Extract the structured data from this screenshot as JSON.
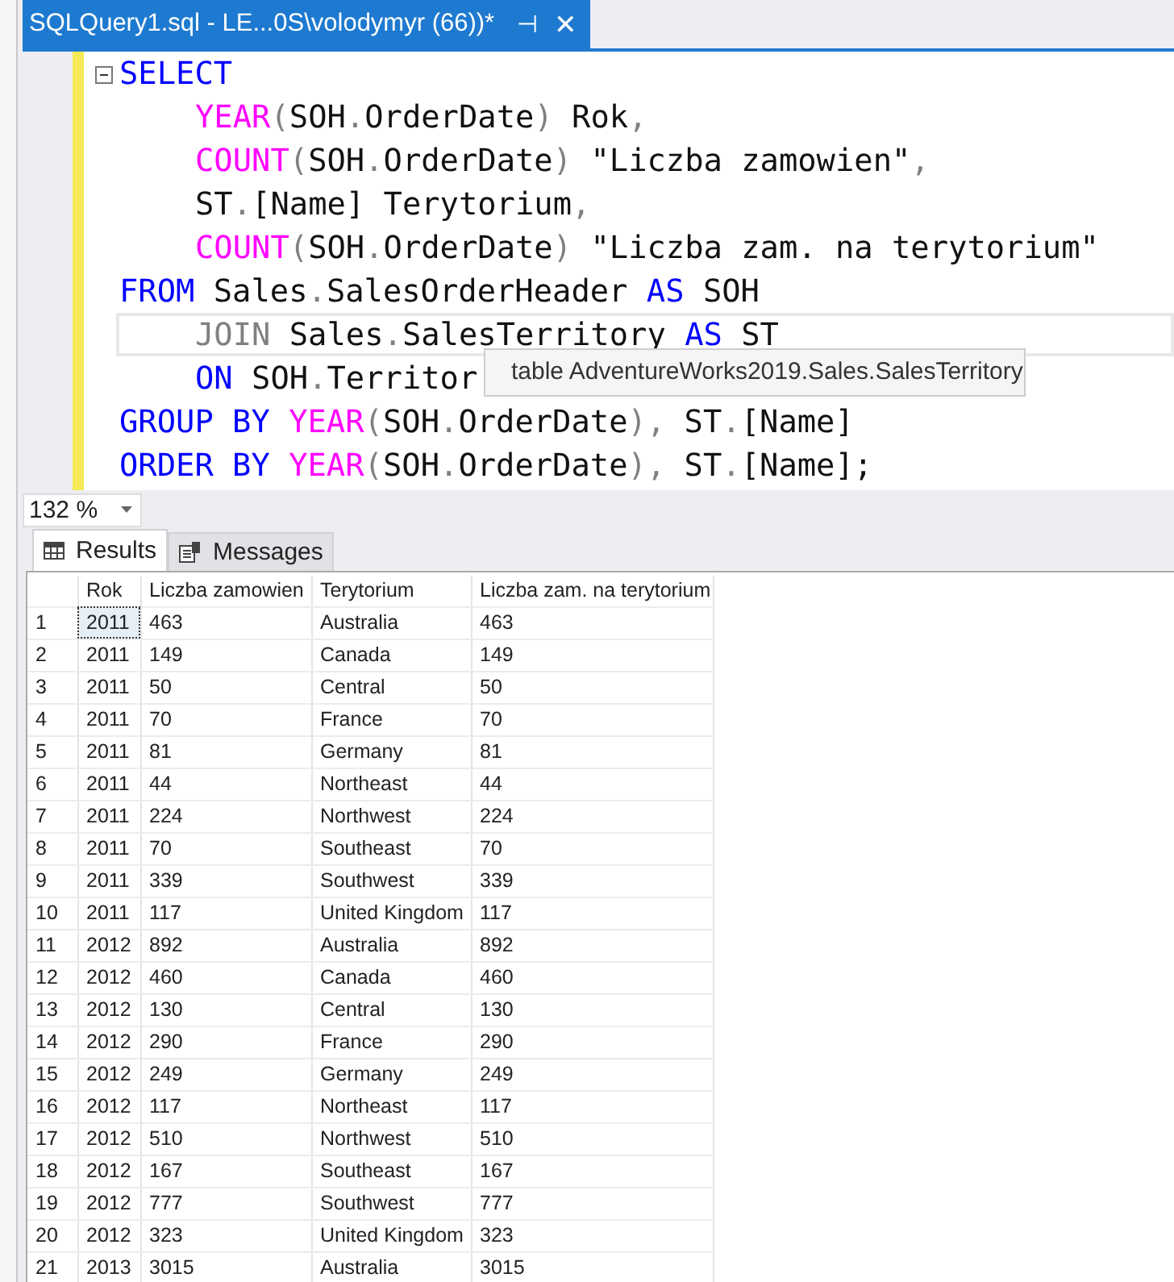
{
  "document_tab": {
    "title": "SQLQuery1.sql - LE...0S\\volodymyr (66))*",
    "pin": "⊣",
    "close": "✕",
    "selected": true
  },
  "editor": {
    "lines": [
      {
        "indented": false,
        "collapsible": true,
        "current": false,
        "tokens": [
          {
            "kind": "keyword",
            "t": "SELECT"
          }
        ]
      },
      {
        "indented": true,
        "collapsible": false,
        "current": false,
        "tokens": [
          {
            "kind": "function",
            "t": "YEAR"
          },
          {
            "kind": "punct",
            "t": "("
          },
          {
            "kind": "plain",
            "t": "SOH"
          },
          {
            "kind": "punct",
            "t": "."
          },
          {
            "kind": "plain",
            "t": "OrderDate"
          },
          {
            "kind": "punct",
            "t": ")"
          },
          {
            "kind": "plain",
            "t": " Rok"
          },
          {
            "kind": "punct",
            "t": ","
          }
        ]
      },
      {
        "indented": true,
        "collapsible": false,
        "current": false,
        "tokens": [
          {
            "kind": "function",
            "t": "COUNT"
          },
          {
            "kind": "punct",
            "t": "("
          },
          {
            "kind": "plain",
            "t": "SOH"
          },
          {
            "kind": "punct",
            "t": "."
          },
          {
            "kind": "plain",
            "t": "OrderDate"
          },
          {
            "kind": "punct",
            "t": ")"
          },
          {
            "kind": "plain",
            "t": " \"Liczba zamowien\""
          },
          {
            "kind": "punct",
            "t": ","
          }
        ]
      },
      {
        "indented": true,
        "collapsible": false,
        "current": false,
        "tokens": [
          {
            "kind": "plain",
            "t": "ST"
          },
          {
            "kind": "punct",
            "t": "."
          },
          {
            "kind": "plain",
            "t": "[Name] Terytorium"
          },
          {
            "kind": "punct",
            "t": ","
          }
        ]
      },
      {
        "indented": true,
        "collapsible": false,
        "current": false,
        "tokens": [
          {
            "kind": "function",
            "t": "COUNT"
          },
          {
            "kind": "punct",
            "t": "("
          },
          {
            "kind": "plain",
            "t": "SOH"
          },
          {
            "kind": "punct",
            "t": "."
          },
          {
            "kind": "plain",
            "t": "OrderDate"
          },
          {
            "kind": "punct",
            "t": ")"
          },
          {
            "kind": "plain",
            "t": " \"Liczba zam. na terytorium\""
          }
        ]
      },
      {
        "indented": false,
        "collapsible": false,
        "current": false,
        "tokens": [
          {
            "kind": "keyword",
            "t": "FROM"
          },
          {
            "kind": "plain",
            "t": " Sales"
          },
          {
            "kind": "punct",
            "t": "."
          },
          {
            "kind": "plain",
            "t": "SalesOrderHeader "
          },
          {
            "kind": "keyword",
            "t": "AS"
          },
          {
            "kind": "plain",
            "t": " SOH"
          }
        ]
      },
      {
        "indented": true,
        "collapsible": false,
        "current": true,
        "tokens": [
          {
            "kind": "muted",
            "t": "JOIN"
          },
          {
            "kind": "plain",
            "t": " Sales"
          },
          {
            "kind": "punct",
            "t": "."
          },
          {
            "kind": "plain",
            "t": "SalesTerritory "
          },
          {
            "kind": "keyword",
            "t": "AS"
          },
          {
            "kind": "plain",
            "t": " ST"
          }
        ]
      },
      {
        "indented": true,
        "collapsible": false,
        "current": false,
        "tokens": [
          {
            "kind": "keyword",
            "t": "ON"
          },
          {
            "kind": "plain",
            "t": " SOH"
          },
          {
            "kind": "punct",
            "t": "."
          },
          {
            "kind": "plain",
            "t": "Territor"
          }
        ]
      },
      {
        "indented": false,
        "collapsible": false,
        "current": false,
        "tokens": [
          {
            "kind": "keyword",
            "t": "GROUP BY "
          },
          {
            "kind": "function",
            "t": "YEAR"
          },
          {
            "kind": "punct",
            "t": "("
          },
          {
            "kind": "plain",
            "t": "SOH"
          },
          {
            "kind": "punct",
            "t": "."
          },
          {
            "kind": "plain",
            "t": "OrderDate"
          },
          {
            "kind": "punct",
            "t": "),"
          },
          {
            "kind": "plain",
            "t": " ST"
          },
          {
            "kind": "punct",
            "t": "."
          },
          {
            "kind": "plain",
            "t": "[Name]"
          }
        ]
      },
      {
        "indented": false,
        "collapsible": false,
        "current": false,
        "tokens": [
          {
            "kind": "keyword",
            "t": "ORDER BY "
          },
          {
            "kind": "function",
            "t": "YEAR"
          },
          {
            "kind": "punct",
            "t": "("
          },
          {
            "kind": "plain",
            "t": "SOH"
          },
          {
            "kind": "punct",
            "t": "."
          },
          {
            "kind": "plain",
            "t": "OrderDate"
          },
          {
            "kind": "punct",
            "t": "),"
          },
          {
            "kind": "plain",
            "t": " ST"
          },
          {
            "kind": "punct",
            "t": "."
          },
          {
            "kind": "plain",
            "t": "[Name];"
          }
        ]
      }
    ],
    "tooltip": "table AdventureWorks2019.Sales.SalesTerritory"
  },
  "zoom": "132 %",
  "result_tabs": [
    {
      "label": "Results",
      "selected": true
    },
    {
      "label": "Messages",
      "selected": false
    }
  ],
  "table": {
    "columns": [
      "Rok",
      "Liczba zamowien",
      "Terytorium",
      "Liczba zam. na terytorium"
    ],
    "rows": [
      {
        "n": "1",
        "cells": [
          "2011",
          "463",
          "Australia",
          "463"
        ],
        "focused": true
      },
      {
        "n": "2",
        "cells": [
          "2011",
          "149",
          "Canada",
          "149"
        ],
        "focused": false
      },
      {
        "n": "3",
        "cells": [
          "2011",
          "50",
          "Central",
          "50"
        ],
        "focused": false
      },
      {
        "n": "4",
        "cells": [
          "2011",
          "70",
          "France",
          "70"
        ],
        "focused": false
      },
      {
        "n": "5",
        "cells": [
          "2011",
          "81",
          "Germany",
          "81"
        ],
        "focused": false
      },
      {
        "n": "6",
        "cells": [
          "2011",
          "44",
          "Northeast",
          "44"
        ],
        "focused": false
      },
      {
        "n": "7",
        "cells": [
          "2011",
          "224",
          "Northwest",
          "224"
        ],
        "focused": false
      },
      {
        "n": "8",
        "cells": [
          "2011",
          "70",
          "Southeast",
          "70"
        ],
        "focused": false
      },
      {
        "n": "9",
        "cells": [
          "2011",
          "339",
          "Southwest",
          "339"
        ],
        "focused": false
      },
      {
        "n": "10",
        "cells": [
          "2011",
          "117",
          "United Kingdom",
          "117"
        ],
        "focused": false
      },
      {
        "n": "11",
        "cells": [
          "2012",
          "892",
          "Australia",
          "892"
        ],
        "focused": false
      },
      {
        "n": "12",
        "cells": [
          "2012",
          "460",
          "Canada",
          "460"
        ],
        "focused": false
      },
      {
        "n": "13",
        "cells": [
          "2012",
          "130",
          "Central",
          "130"
        ],
        "focused": false
      },
      {
        "n": "14",
        "cells": [
          "2012",
          "290",
          "France",
          "290"
        ],
        "focused": false
      },
      {
        "n": "15",
        "cells": [
          "2012",
          "249",
          "Germany",
          "249"
        ],
        "focused": false
      },
      {
        "n": "16",
        "cells": [
          "2012",
          "117",
          "Northeast",
          "117"
        ],
        "focused": false
      },
      {
        "n": "17",
        "cells": [
          "2012",
          "510",
          "Northwest",
          "510"
        ],
        "focused": false
      },
      {
        "n": "18",
        "cells": [
          "2012",
          "167",
          "Southeast",
          "167"
        ],
        "focused": false
      },
      {
        "n": "19",
        "cells": [
          "2012",
          "777",
          "Southwest",
          "777"
        ],
        "focused": false
      },
      {
        "n": "20",
        "cells": [
          "2012",
          "323",
          "United Kingdom",
          "323"
        ],
        "focused": false
      },
      {
        "n": "21",
        "cells": [
          "2013",
          "3015",
          "Australia",
          "3015"
        ],
        "focused": false
      }
    ]
  }
}
